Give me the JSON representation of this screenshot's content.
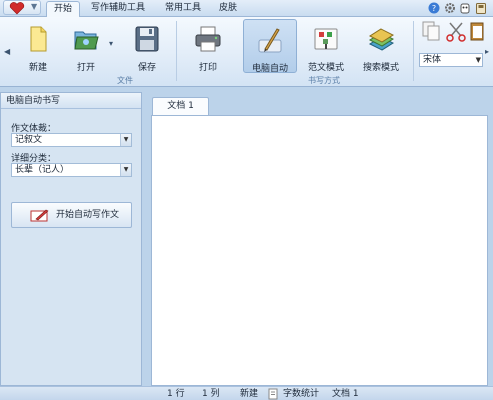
{
  "menu": {
    "tabs": [
      {
        "label": "开始"
      },
      {
        "label": "写作辅助工具"
      },
      {
        "label": "常用工具"
      },
      {
        "label": "皮肤"
      }
    ],
    "icons": [
      "help-icon",
      "settings-icon",
      "skin-icon",
      "user-icon"
    ]
  },
  "ribbon": {
    "buttons": {
      "new": "新建",
      "open": "打开",
      "save": "保存",
      "print": "打印",
      "auto": "电脑自动",
      "sample": "范文模式",
      "search": "搜索模式"
    },
    "groups": {
      "file": "文件",
      "write": "书写方式"
    },
    "font": "宋体"
  },
  "panel": {
    "title": "电脑自动书写",
    "genre_label": "作文体裁：",
    "genre_value": "记叙文",
    "category_label": "详细分类：",
    "category_value": "长辈（记人）",
    "start_button": "开始自动写作文"
  },
  "document": {
    "tab": "文档 1"
  },
  "status": {
    "row": "1 行",
    "col": "1 列",
    "new": "新建",
    "wordcount": "字数统计",
    "doc": "文档 1"
  },
  "colors": {
    "accent": "#bcd3ea",
    "ribbon": "#e1ecf8",
    "selected": "#b2cdea"
  }
}
